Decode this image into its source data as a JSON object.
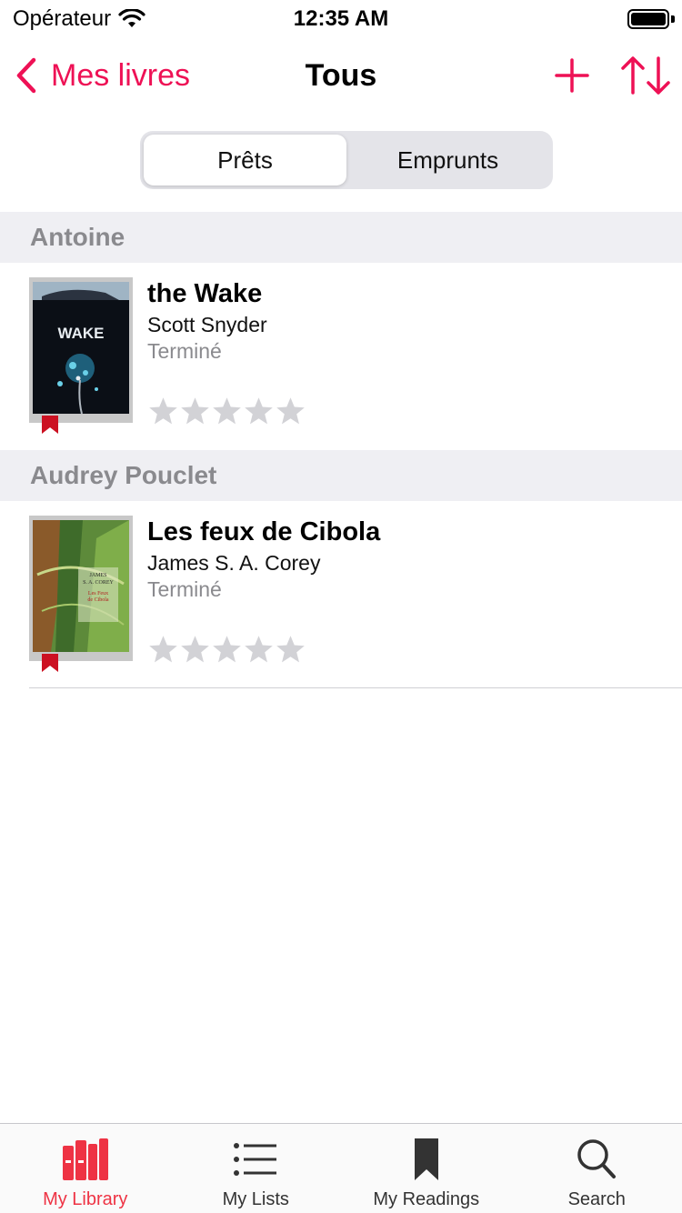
{
  "status_bar": {
    "carrier": "Opérateur",
    "time": "12:35 AM"
  },
  "nav": {
    "back_label": "Mes livres",
    "title": "Tous",
    "accent": "#ee1155"
  },
  "segmented": {
    "options": [
      "Prêts",
      "Emprunts"
    ],
    "selected": "Prêts"
  },
  "sections": [
    {
      "header": "Antoine",
      "books": [
        {
          "title": "the Wake",
          "author": "Scott Snyder",
          "status": "Terminé",
          "rating": 0,
          "max_rating": 5,
          "cover_text": "THE WAKE"
        }
      ]
    },
    {
      "header": "Audrey Pouclet",
      "books": [
        {
          "title": "Les feux de Cibola",
          "author": "James S. A. Corey",
          "status": "Terminé",
          "rating": 0,
          "max_rating": 5,
          "cover_text": "JAMES S. A. COREY"
        }
      ]
    }
  ],
  "tab_bar": {
    "items": [
      {
        "label": "My Library",
        "icon": "library-books-icon",
        "active": true
      },
      {
        "label": "My Lists",
        "icon": "list-icon",
        "active": false
      },
      {
        "label": "My Readings",
        "icon": "bookmark-icon",
        "active": false
      },
      {
        "label": "Search",
        "icon": "magnifier-icon",
        "active": false
      }
    ]
  }
}
